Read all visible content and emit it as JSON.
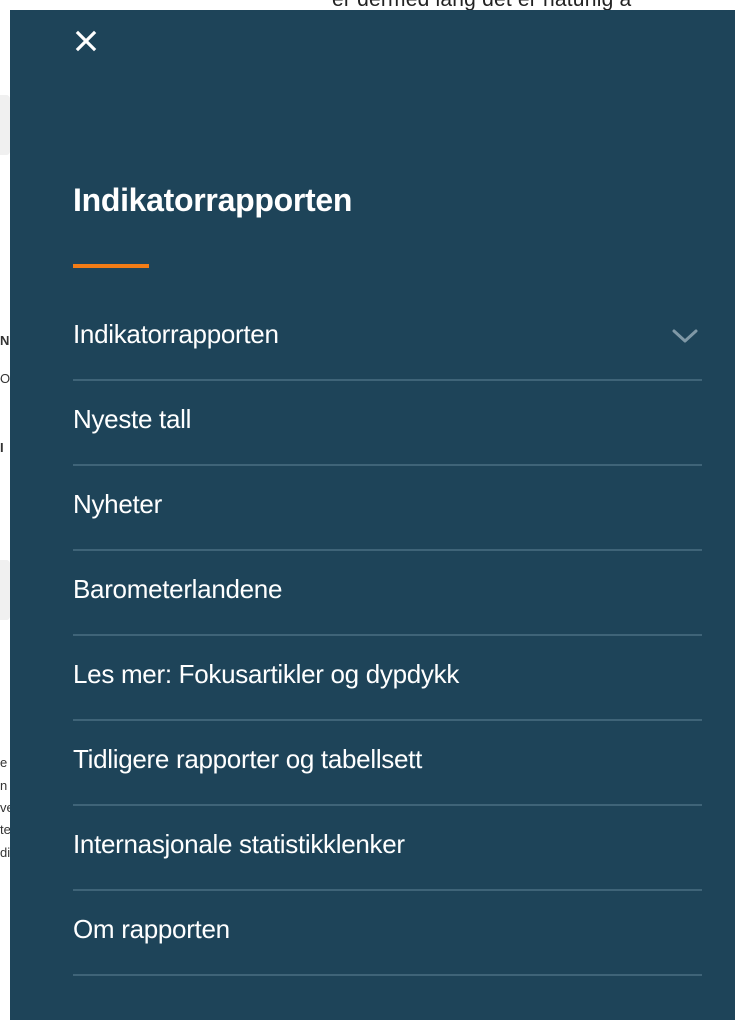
{
  "background": {
    "top_text": "er dermed lang det er naturlig å",
    "left_slivers": [
      {
        "text": "N",
        "row": 1
      },
      {
        "text": "O",
        "row": 2
      },
      {
        "text": "I",
        "row": 3
      },
      {
        "text": "e",
        "row": 4
      },
      {
        "text": "n",
        "row": 5
      },
      {
        "text": "ve",
        "row": 6
      },
      {
        "text": "te",
        "row": 7
      },
      {
        "text": "di",
        "row": 8
      }
    ]
  },
  "menu": {
    "close_icon": "close-icon",
    "title": "Indikatorrapporten",
    "accent_color": "#f27c16",
    "background_color": "#1e4459",
    "items": [
      {
        "label": "Indikatorrapporten",
        "has_chevron": true,
        "icon": "chevron-down-icon"
      },
      {
        "label": "Nyeste tall"
      },
      {
        "label": "Nyheter"
      },
      {
        "label": "Barometerlandene"
      },
      {
        "label": "Les mer: Fokusartikler og dypdykk"
      },
      {
        "label": "Tidligere rapporter og tabellsett"
      },
      {
        "label": "Internasjonale statistikklenker"
      },
      {
        "label": "Om rapporten"
      }
    ]
  }
}
